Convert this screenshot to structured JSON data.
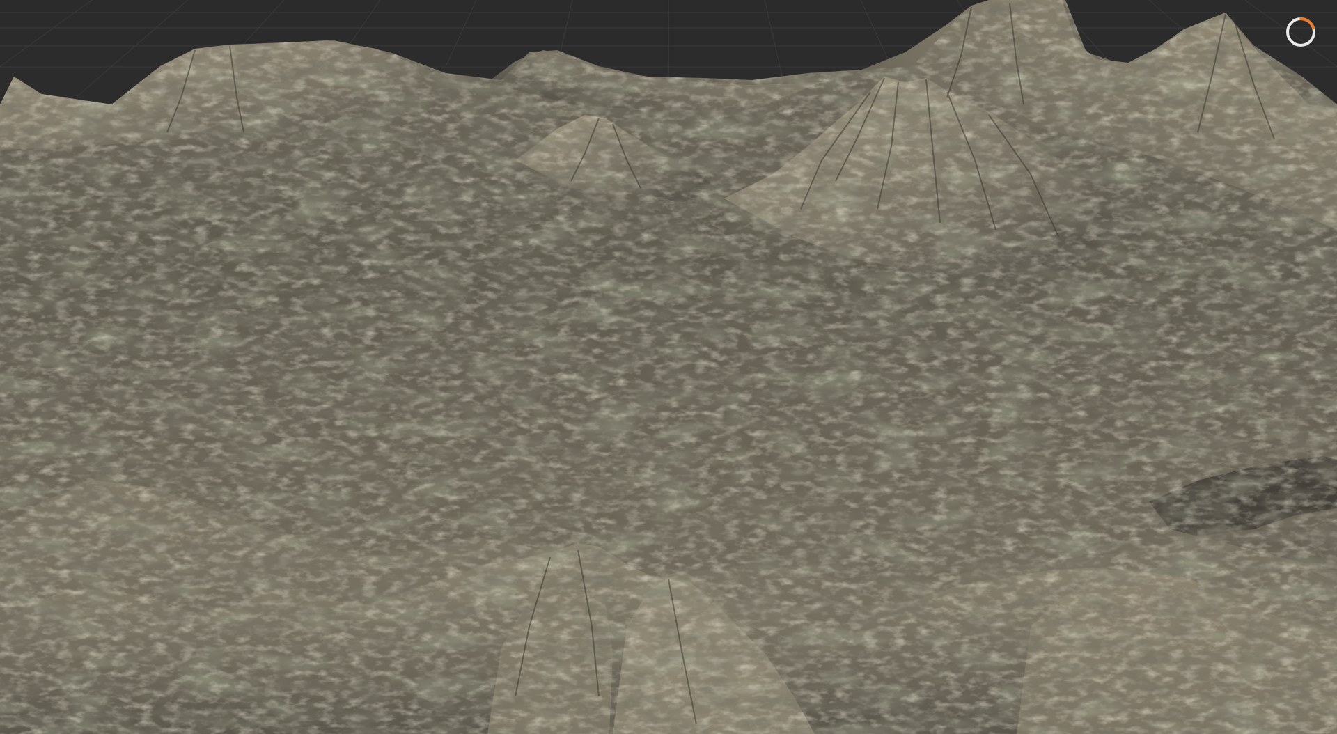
{
  "viewport": {
    "background_color": "#2b2b2c",
    "grid_color": "#3a3a3b",
    "terrain": {
      "base_color": "#7a7364",
      "shadow_color": "#3b3933",
      "highlight_color": "#a59c85",
      "moss_color": "#6b7454"
    }
  },
  "status_indicator": {
    "icon": "loading-ring-icon",
    "ring_color": "#e8e8e8",
    "accent_color": "#e87a2a",
    "progress": 0.2
  }
}
